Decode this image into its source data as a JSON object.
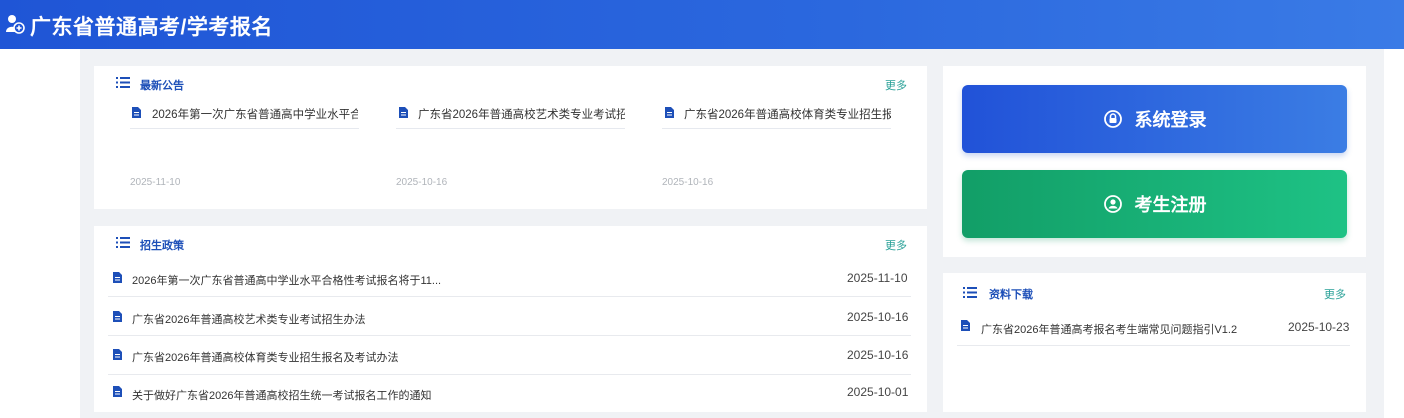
{
  "header": {
    "title": "广东省普通高考/学考报名",
    "logo_icon": "user-add-icon"
  },
  "notices": {
    "title": "最新公告",
    "more": "更多",
    "items": [
      {
        "title": "2026年第一次广东省普通高中学业水平合",
        "date": "2025-11-10"
      },
      {
        "title": "广东省2026年普通高校艺术类专业考试招",
        "date": "2025-10-16"
      },
      {
        "title": "广东省2026年普通高校体育类专业招生报",
        "date": "2025-10-16"
      }
    ]
  },
  "policy": {
    "title": "招生政策",
    "more": "更多",
    "items": [
      {
        "title": "2026年第一次广东省普通高中学业水平合格性考试报名将于11...",
        "date": "2025-11-10"
      },
      {
        "title": "广东省2026年普通高校艺术类专业考试招生办法",
        "date": "2025-10-16"
      },
      {
        "title": "广东省2026年普通高校体育类专业招生报名及考试办法",
        "date": "2025-10-16"
      },
      {
        "title": "关于做好广东省2026年普通高校招生统一考试报名工作的通知",
        "date": "2025-10-01"
      }
    ]
  },
  "actions": {
    "login_label": "系统登录",
    "register_label": "考生注册",
    "login_color": "#2152d8",
    "register_color": "#16a870"
  },
  "downloads": {
    "title": "资料下载",
    "more": "更多",
    "items": [
      {
        "title": "广东省2026年普通高考报名考生端常见问题指引V1.2",
        "date": "2025-10-23"
      }
    ]
  }
}
